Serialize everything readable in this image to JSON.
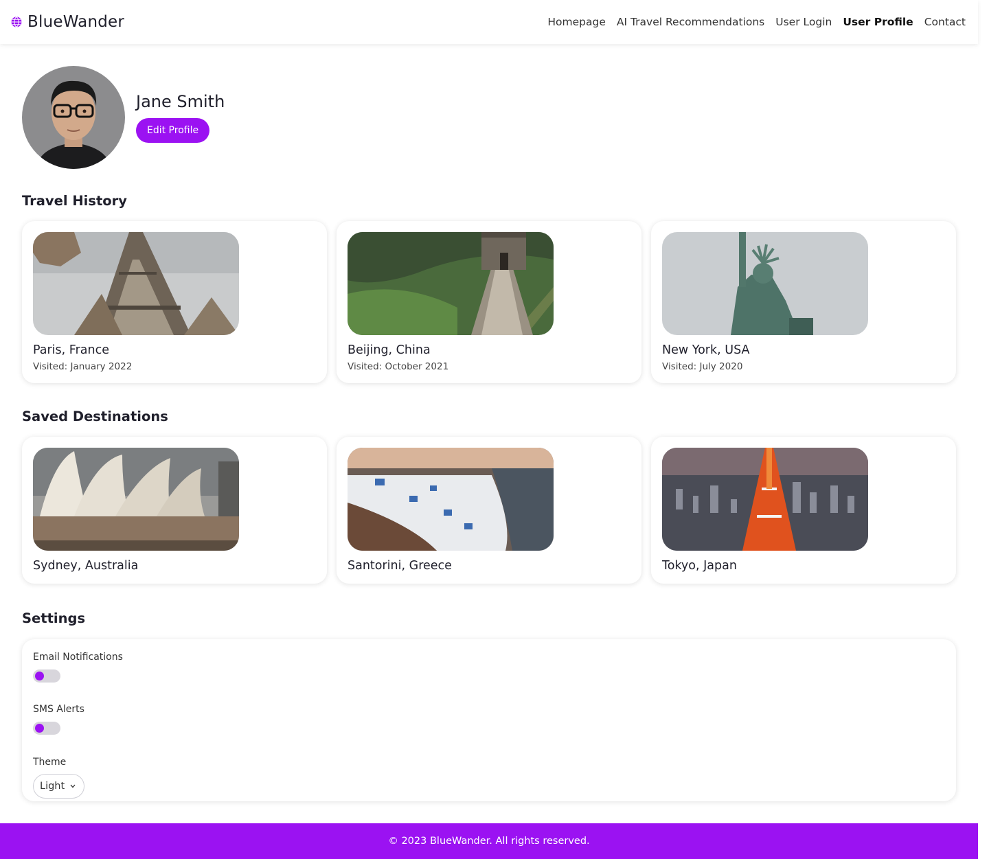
{
  "nav": {
    "brand": "BlueWander",
    "links": [
      "Homepage",
      "AI Travel Recommendations",
      "User Login",
      "User Profile",
      "Contact"
    ],
    "active_link": "User Profile"
  },
  "profile": {
    "name": "Jane Smith",
    "edit_label": "Edit Profile"
  },
  "travel_history": {
    "title": "Travel History",
    "items": [
      {
        "place": "Paris, France",
        "visited": "Visited: January 2022"
      },
      {
        "place": "Beijing, China",
        "visited": "Visited: October 2021"
      },
      {
        "place": "New York, USA",
        "visited": "Visited: July 2020"
      }
    ]
  },
  "saved_destinations": {
    "title": "Saved Destinations",
    "items": [
      {
        "place": "Sydney, Australia"
      },
      {
        "place": "Santorini, Greece"
      },
      {
        "place": "Tokyo, Japan"
      }
    ]
  },
  "settings": {
    "title": "Settings",
    "email_label": "Email Notifications",
    "sms_label": "SMS Alerts",
    "theme_label": "Theme",
    "theme_value": "Light"
  },
  "footer": {
    "text": "© 2023 BlueWander. All rights reserved."
  },
  "colors": {
    "accent": "#9b12f2"
  }
}
